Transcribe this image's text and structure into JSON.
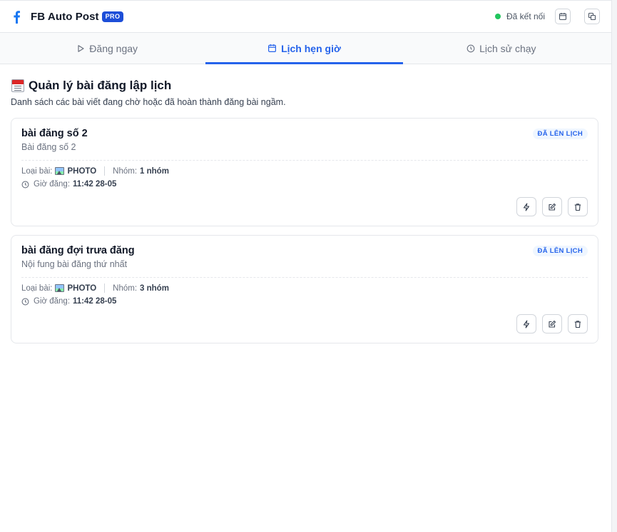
{
  "header": {
    "brand_title": "FB Auto Post",
    "pro_badge": "PRO",
    "status_text": "Đã kết nối",
    "colors": {
      "brand": "#1877f2",
      "accent": "#2563eb",
      "status": "#22c55e"
    }
  },
  "tabs": [
    {
      "label": "Đăng ngay",
      "icon": "play-icon",
      "active": false
    },
    {
      "label": "Lịch hẹn giờ",
      "icon": "calendar-icon",
      "active": true
    },
    {
      "label": "Lịch sử chạy",
      "icon": "clock-icon",
      "active": false
    }
  ],
  "page": {
    "title": "Quản lý bài đăng lập lịch",
    "subtitle": "Danh sách các bài viết đang chờ hoặc đã hoàn thành đăng bài ngầm."
  },
  "labels": {
    "type_label": "Loại bài:",
    "group_label": "Nhóm:",
    "time_label": "Giờ đăng:"
  },
  "posts": [
    {
      "title": "bài đăng số 2",
      "content": "Bài đăng số 2",
      "status": "ĐÃ LÊN LỊCH",
      "type": "PHOTO",
      "groups": "1 nhóm",
      "time": "11:42 28-05"
    },
    {
      "title": "bài đăng đợi trưa đăng",
      "content": "Nội fung bài đăng thứ nhất",
      "status": "ĐÃ LÊN LỊCH",
      "type": "PHOTO",
      "groups": "3 nhóm",
      "time": "11:42 28-05"
    }
  ]
}
